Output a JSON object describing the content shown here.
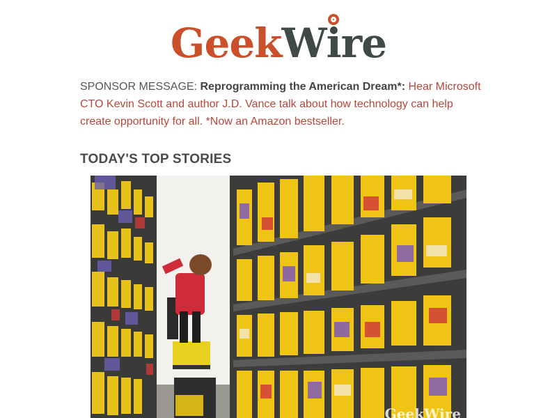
{
  "header": {
    "logo_part1": "Geek",
    "logo_part2a": "W",
    "logo_part2b": "i",
    "logo_part2c": "re"
  },
  "sponsor": {
    "prefix": "SPONSOR MESSAGE: ",
    "headline": "Reprogramming the American Dream*:",
    "body": " Hear Microsoft CTO Kevin Scott and author J.D. Vance talk about how technology can help create opportunity for all. *Now an Amazon bestseller."
  },
  "stories": {
    "section_title": "TODAY'S TOP STORIES"
  },
  "photo": {
    "watermark": "GeekWire"
  },
  "colors": {
    "brand_orange": "#c9502a",
    "brand_dark": "#3f4a48",
    "link": "#b5473a"
  }
}
